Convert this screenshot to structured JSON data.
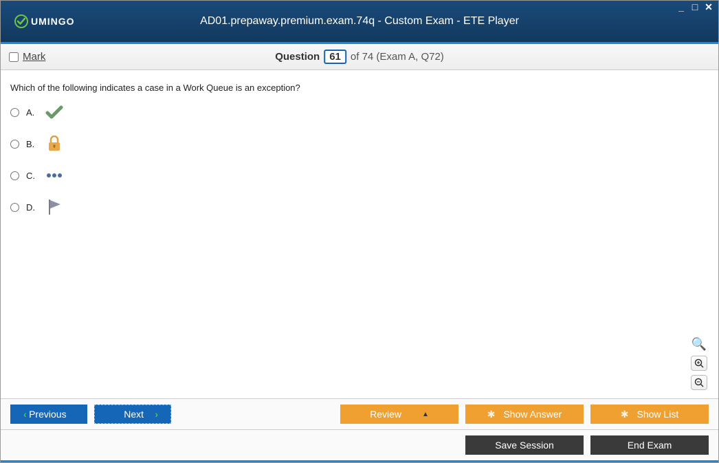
{
  "window": {
    "title": "AD01.prepaway.premium.exam.74q - Custom Exam - ETE Player",
    "logo_text": "UMINGO"
  },
  "toolbar": {
    "mark_label": "Mark",
    "question_label": "Question",
    "question_number": "61",
    "question_rest": "of 74 (Exam A, Q72)"
  },
  "question": {
    "text": "Which of the following indicates a case in a Work Queue is an exception?",
    "options": {
      "a": {
        "letter": "A."
      },
      "b": {
        "letter": "B."
      },
      "c": {
        "letter": "C."
      },
      "d": {
        "letter": "D."
      }
    }
  },
  "nav": {
    "previous": "Previous",
    "next": "Next",
    "review": "Review",
    "show_answer": "Show Answer",
    "show_list": "Show List"
  },
  "footer": {
    "save_session": "Save Session",
    "end_exam": "End Exam"
  }
}
